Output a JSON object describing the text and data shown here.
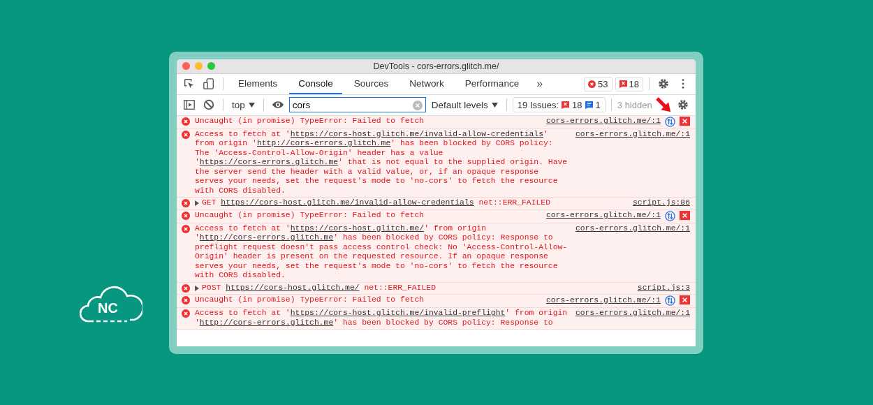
{
  "window": {
    "title": "DevTools - cors-errors.glitch.me/"
  },
  "tabs": [
    {
      "label": "Elements",
      "selected": false
    },
    {
      "label": "Console",
      "selected": true
    },
    {
      "label": "Sources",
      "selected": false
    },
    {
      "label": "Network",
      "selected": false
    },
    {
      "label": "Performance",
      "selected": false
    }
  ],
  "more_tabs": "»",
  "error_count": "53",
  "issue_count": "18",
  "filter_bar": {
    "context": "top",
    "search": {
      "value": "cors"
    },
    "levels": "Default levels",
    "issues_label": "19 Issues:",
    "issues_errors": "18",
    "issues_info": "1",
    "hidden": "3 hidden"
  },
  "messages": [
    {
      "expandable": false,
      "actions": true,
      "source": "cors-errors.glitch.me/:1",
      "parts": [
        {
          "text": "Uncaught (in promise) TypeError: Failed to fetch",
          "link": false
        }
      ]
    },
    {
      "expandable": false,
      "actions": false,
      "source": "cors-errors.glitch.me/:1",
      "parts": [
        {
          "text": "Access to fetch at '",
          "link": false
        },
        {
          "text": "https://cors-host.glitch.me/invalid-allow-credentials",
          "link": true
        },
        {
          "text": "' from origin '",
          "link": false
        },
        {
          "text": "http://cors-errors.glitch.me",
          "link": true
        },
        {
          "text": "' has been blocked by CORS policy: The 'Access-Control-Allow-Origin' header has a value '",
          "link": false
        },
        {
          "text": "https://cors-errors.glitch.me",
          "link": true
        },
        {
          "text": "' that is not equal to the supplied origin. Have the server send the header with a valid value, or, if an opaque response serves your needs, set the request's mode to 'no-cors' to fetch the resource with CORS disabled.",
          "link": false
        }
      ]
    },
    {
      "expandable": true,
      "actions": false,
      "source": "script.js:86",
      "parts": [
        {
          "text": "GET ",
          "link": false
        },
        {
          "text": "https://cors-host.glitch.me/invalid-allow-credentials",
          "link": true
        },
        {
          "text": " net::ERR_FAILED",
          "link": false
        }
      ]
    },
    {
      "expandable": false,
      "actions": true,
      "source": "cors-errors.glitch.me/:1",
      "parts": [
        {
          "text": "Uncaught (in promise) TypeError: Failed to fetch",
          "link": false
        }
      ]
    },
    {
      "expandable": false,
      "actions": false,
      "source": "cors-errors.glitch.me/:1",
      "parts": [
        {
          "text": "Access to fetch at '",
          "link": false
        },
        {
          "text": "https://cors-host.glitch.me/",
          "link": true
        },
        {
          "text": "' from origin '",
          "link": false
        },
        {
          "text": "http://cors-errors.glitch.me",
          "link": true
        },
        {
          "text": "' has been blocked by CORS policy: Response to preflight request doesn't pass access control check: No 'Access-Control-Allow-Origin' header is present on the requested resource. If an opaque response serves your needs, set the request's mode to 'no-cors' to fetch the resource with CORS disabled.",
          "link": false
        }
      ]
    },
    {
      "expandable": true,
      "actions": false,
      "source": "script.js:3",
      "parts": [
        {
          "text": "POST ",
          "link": false
        },
        {
          "text": "https://cors-host.glitch.me/",
          "link": true
        },
        {
          "text": " net::ERR_FAILED",
          "link": false
        }
      ]
    },
    {
      "expandable": false,
      "actions": true,
      "source": "cors-errors.glitch.me/:1",
      "parts": [
        {
          "text": "Uncaught (in promise) TypeError: Failed to fetch",
          "link": false
        }
      ]
    },
    {
      "expandable": false,
      "actions": false,
      "source": "cors-errors.glitch.me/:1",
      "parts": [
        {
          "text": "Access to fetch at '",
          "link": false
        },
        {
          "text": "https://cors-host.glitch.me/invalid-preflight",
          "link": true
        },
        {
          "text": "' from origin '",
          "link": false
        },
        {
          "text": "http://cors-errors.glitch.me",
          "link": true
        },
        {
          "text": "' has been blocked by CORS policy: Response to",
          "link": false
        }
      ]
    }
  ],
  "logo": {
    "text": "NC"
  }
}
